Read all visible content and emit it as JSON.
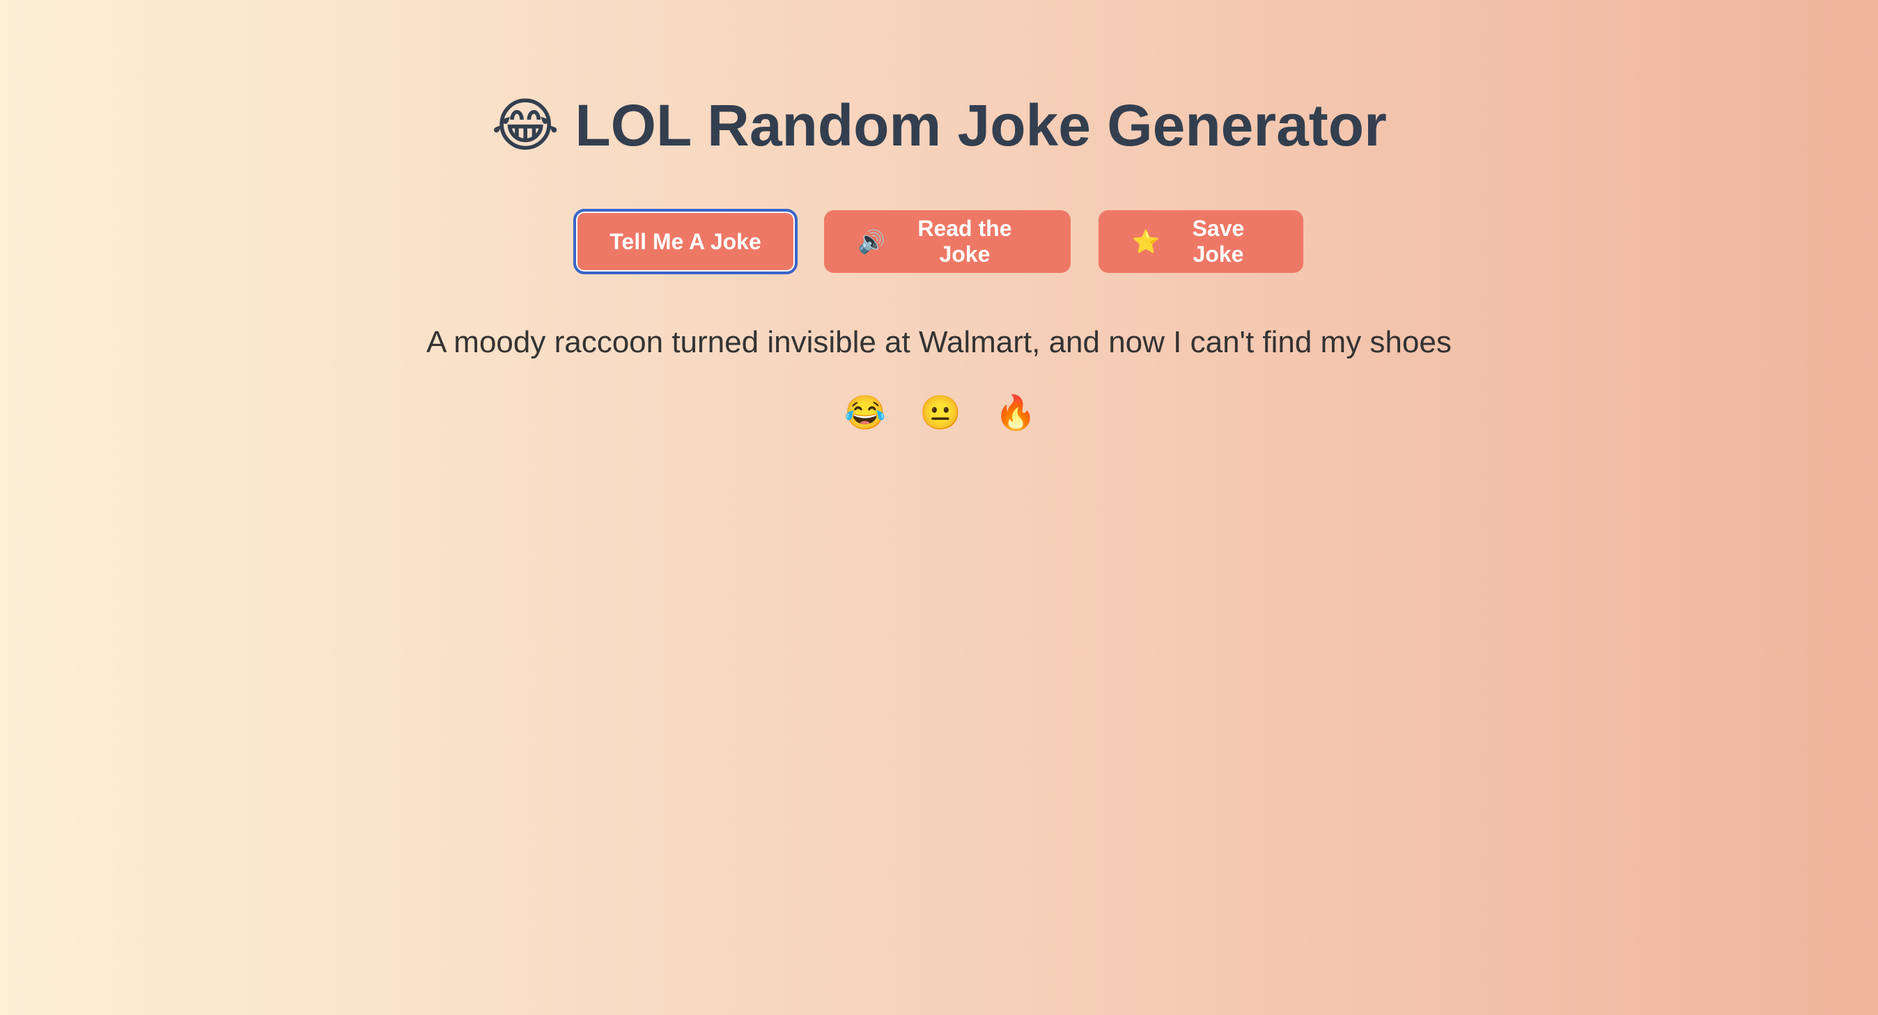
{
  "header": {
    "title_emoji": "😂",
    "title_text": "LOL Random Joke Generator"
  },
  "buttons": {
    "tell": {
      "label": "Tell Me A Joke"
    },
    "read": {
      "icon": "🔊",
      "icon_name": "speaker-icon",
      "label": "Read the Joke"
    },
    "save": {
      "icon": "⭐",
      "icon_name": "star-icon",
      "label": "Save Joke"
    }
  },
  "joke": {
    "text": "A moody raccoon turned invisible at Walmart, and now I can't find my shoes"
  },
  "reactions": [
    {
      "emoji": "😂",
      "name": "laughing-face-icon"
    },
    {
      "emoji": "😐",
      "name": "neutral-face-icon"
    },
    {
      "emoji": "🔥",
      "name": "fire-icon"
    }
  ],
  "colors": {
    "button_bg": "#ee7866",
    "title": "#333f4f",
    "focus_ring": "#3a64c8"
  }
}
